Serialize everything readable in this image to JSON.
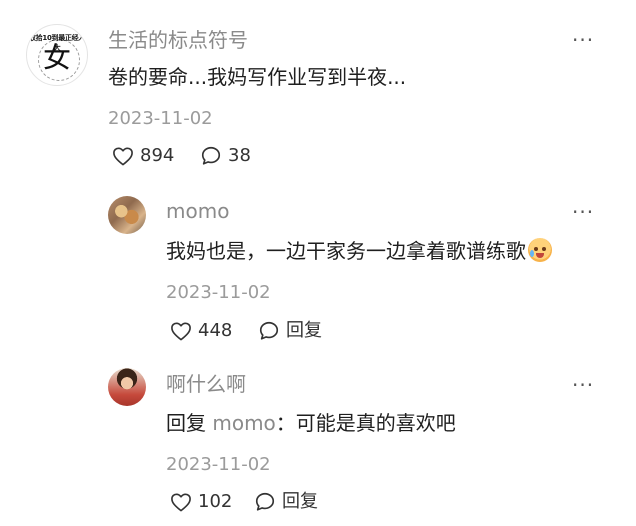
{
  "comments": [
    {
      "username": "生活的标点符号",
      "avatar_logo_text": "收拾10到最正经人大",
      "avatar_logo_char": "女",
      "text": "卷的要命...我妈写作业写到半夜...",
      "date": "2023-11-02",
      "likes": "894",
      "replies": "38",
      "more_label": "···"
    },
    {
      "username": "momo",
      "text": "我妈也是，一边干家务一边拿着歌谱练歌",
      "date": "2023-11-02",
      "likes": "448",
      "reply_label": "回复",
      "more_label": "···"
    },
    {
      "username": "啊什么啊",
      "text_prefix": "回复",
      "mention": "momo",
      "text_suffix": "：可能是真的喜欢吧",
      "date": "2023-11-02",
      "likes": "102",
      "reply_label": "回复",
      "more_label": "···"
    }
  ],
  "icons": {
    "like": "heart-outline-icon",
    "comment": "speech-bubble-icon",
    "more": "more-dots-icon"
  },
  "colors": {
    "username": "#8a8a8a",
    "date": "#9b9b9b",
    "text": "#1f1f1f"
  }
}
